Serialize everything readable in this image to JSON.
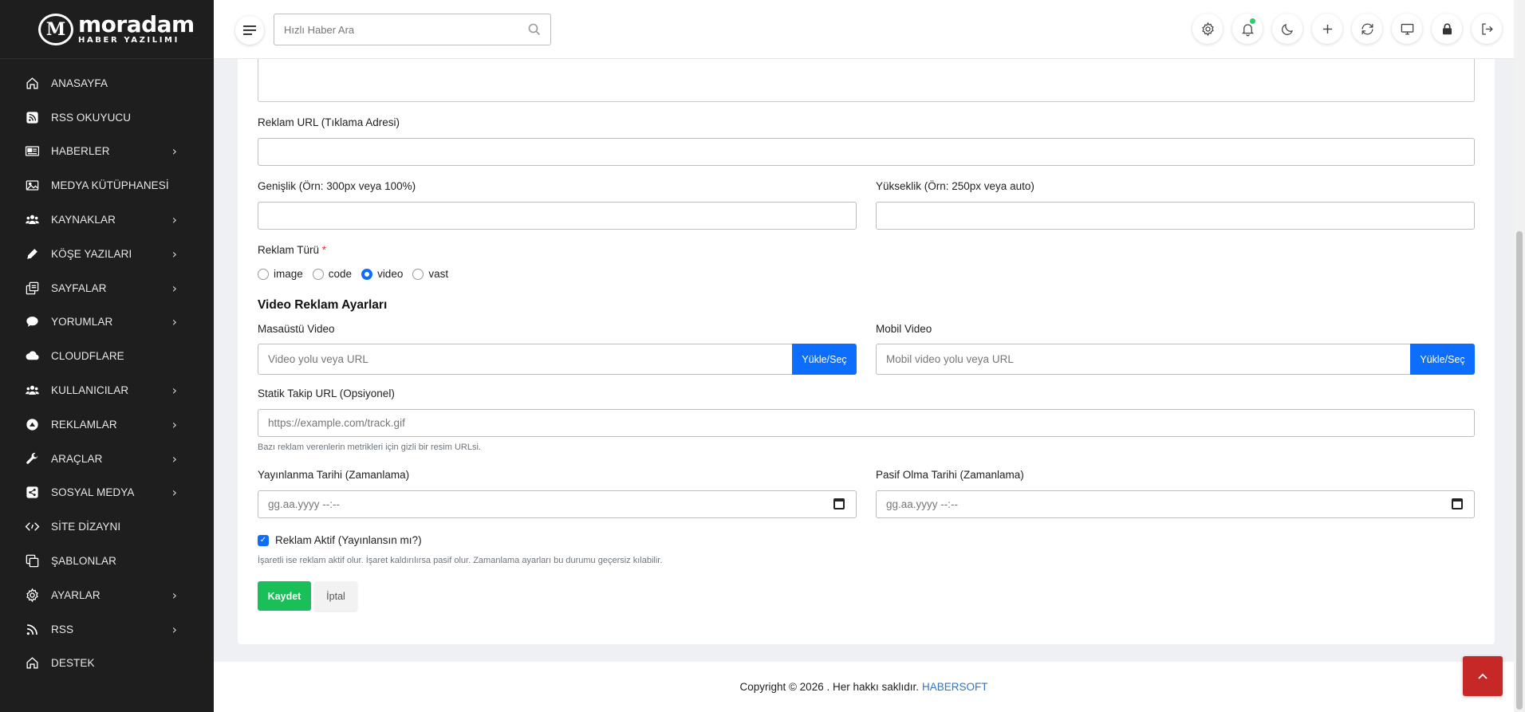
{
  "brand": {
    "logo_big": "moradam",
    "logo_small": "HABER YAZILIMI"
  },
  "sidebar": {
    "items": [
      {
        "label": "ANASAYFA",
        "icon": "home-icon",
        "has_submenu": false
      },
      {
        "label": "RSS OKUYUCU",
        "icon": "rss-icon",
        "has_submenu": false
      },
      {
        "label": "HABERLER",
        "icon": "newspaper-icon",
        "has_submenu": true
      },
      {
        "label": "MEDYA KÜTÜPHANESİ",
        "icon": "image-icon",
        "has_submenu": false
      },
      {
        "label": "KAYNAKLAR",
        "icon": "users-icon",
        "has_submenu": true
      },
      {
        "label": "KÖŞE YAZILARI",
        "icon": "pencil-icon",
        "has_submenu": true
      },
      {
        "label": "SAYFALAR",
        "icon": "pages-icon",
        "has_submenu": true
      },
      {
        "label": "YORUMLAR",
        "icon": "comment-icon",
        "has_submenu": true
      },
      {
        "label": "CLOUDFLARE",
        "icon": "cloud-icon",
        "has_submenu": false
      },
      {
        "label": "KULLANICILAR",
        "icon": "users-icon",
        "has_submenu": true
      },
      {
        "label": "REKLAMLAR",
        "icon": "ad-icon",
        "has_submenu": true
      },
      {
        "label": "ARAÇLAR",
        "icon": "wrench-icon",
        "has_submenu": true
      },
      {
        "label": "SOSYAL MEDYA",
        "icon": "share-icon",
        "has_submenu": true
      },
      {
        "label": "SİTE DİZAYNI",
        "icon": "code-icon",
        "has_submenu": false
      },
      {
        "label": "ŞABLONLAR",
        "icon": "copy-icon",
        "has_submenu": false
      },
      {
        "label": "AYARLAR",
        "icon": "gear-icon",
        "has_submenu": true
      },
      {
        "label": "RSS",
        "icon": "rss-wave-icon",
        "has_submenu": true
      },
      {
        "label": "DESTEK",
        "icon": "home-icon",
        "has_submenu": false
      }
    ]
  },
  "topbar": {
    "search_placeholder": "Hızlı Haber Ara",
    "icons": [
      "gear-icon",
      "bell-icon",
      "moon-icon",
      "plus-icon",
      "sync-icon",
      "monitor-icon",
      "lock-icon",
      "logout-icon"
    ]
  },
  "form": {
    "url_label": "Reklam URL (Tıklama Adresi)",
    "width_label": "Genişlik (Örn: 300px veya 100%)",
    "height_label": "Yükseklik (Örn: 250px veya auto)",
    "type_label": "Reklam Türü",
    "type_required": "*",
    "type_options": [
      "image",
      "code",
      "video",
      "vast"
    ],
    "type_selected": "video",
    "video_section_title": "Video Reklam Ayarları",
    "desktop_video_label": "Masaüstü Video",
    "desktop_video_placeholder": "Video yolu veya URL",
    "mobile_video_label": "Mobil Video",
    "mobile_video_placeholder": "Mobil video yolu veya URL",
    "upload_label": "Yükle/Seç",
    "tracking_label": "Statik Takip URL (Opsiyonel)",
    "tracking_placeholder": "https://example.com/track.gif",
    "tracking_help": "Bazı reklam verenlerin metrikleri için gizli bir resim URLsi.",
    "publish_label": "Yayınlanma Tarihi (Zamanlama)",
    "publish_placeholder": "gg.aa.yyyy --:--",
    "expire_label": "Pasif Olma Tarihi (Zamanlama)",
    "expire_placeholder": "gg.aa.yyyy --:--",
    "active_label": "Reklam Aktif (Yayınlansın mı?)",
    "active_checked": true,
    "active_help": "İşaretli ise reklam aktif olur. İşaret kaldırılırsa pasif olur. Zamanlama ayarları bu durumu geçersiz kılabilir.",
    "save_label": "Kaydet",
    "cancel_label": "İptal"
  },
  "footer": {
    "text": "Copyright © 2026 . Her hakkı saklıdır.",
    "brand": "HABERSOFT"
  },
  "colors": {
    "sidebar_bg": "#1e1e1e",
    "primary": "#0d6efd",
    "success": "#1bbf5a",
    "back_to_top": "#c62828",
    "link": "#2f77c0"
  }
}
